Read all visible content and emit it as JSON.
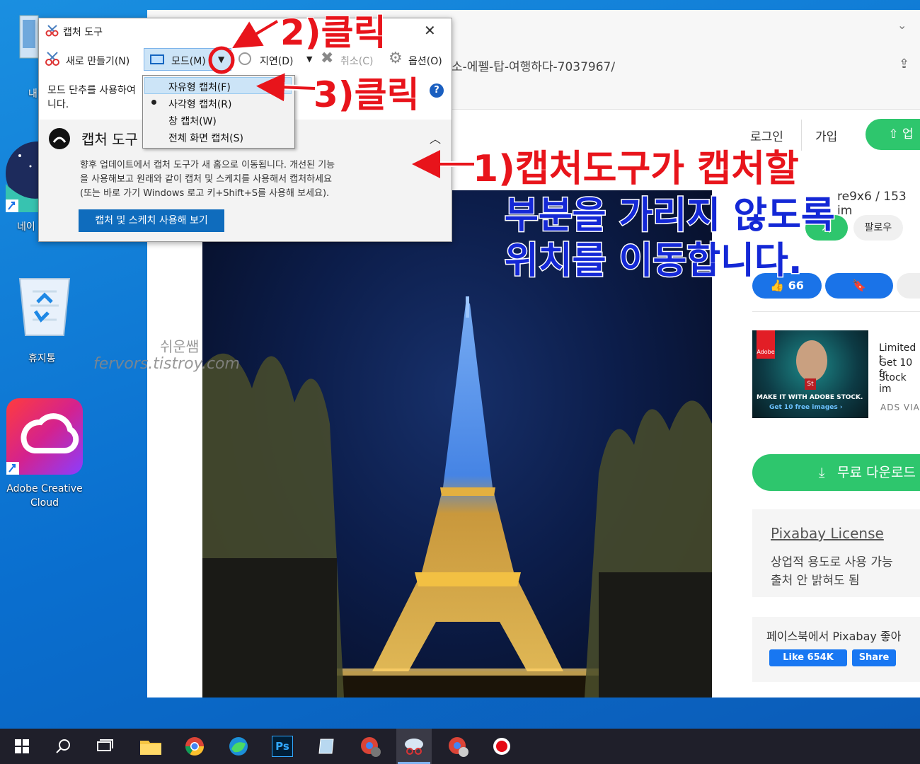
{
  "desktop": {
    "icons": [
      {
        "label": "내"
      },
      {
        "label": "네이"
      },
      {
        "label": "휴지통"
      },
      {
        "label": "Adobe Creative Cloud"
      }
    ],
    "watermark_line1": "쉬운쌤",
    "watermark_line2": "fervors.tistroy.com"
  },
  "browser": {
    "url": "소-에펠-탑-여행하다-7037967/",
    "login": "로그인",
    "join": "가입",
    "upload": "업",
    "author_stats": "re9x6 / 153 im",
    "follow_btn": "지",
    "follow_label": "팔로우",
    "likes": "66",
    "ad": {
      "line1": "Limited t",
      "line2": "Get 10 fr",
      "line3": "Stock im",
      "ads_via": "ADS VIA",
      "banner_title": "MAKE IT WITH ADOBE STOCK.",
      "banner_sub": "Get 10 free images ›",
      "brand": "Adobe",
      "st": "St"
    },
    "download": "무료 다운로드",
    "license_title": "Pixabay License",
    "license_line1": "상업적 용도로 사용 가능",
    "license_line2": "출처 안 밝혀도 됨",
    "fb_text": "페이스북에서 Pixabay 좋아",
    "fb_like": "Like 654K",
    "fb_share": "Share"
  },
  "snip": {
    "title": "캡처 도구",
    "new": "새로 만들기(N)",
    "mode": "모드(M)",
    "delay": "지연(D)",
    "cancel": "취소(C)",
    "options": "옵션(O)",
    "hint1": "모드 단추를 사용하여",
    "hint2": "니다.",
    "panel_title": "캡처 도구",
    "info1": "향후 업데이트에서 캡처 도구가 새 홈으로 이동됩니다. 개선된 기능",
    "info2": "을 사용해보고 원래와 같이 캡처 및 스케치를 사용해서 캡처하세요",
    "info3": "(또는 바로 가기 Windows 로고 키+Shift+S를 사용해 보세요).",
    "try_btn": "캡처 및 스케치 사용해 보기"
  },
  "mode_menu": {
    "items": [
      "자유형 캡처(F)",
      "사각형 캡처(R)",
      "창 캡처(W)",
      "전체 화면 캡처(S)"
    ],
    "selected": "사각형 캡처(R)"
  },
  "annotations": {
    "step1_line1": "1)캡처도구가 캡처할",
    "step1_line2": "부분을 가리지 않도록",
    "step1_line3": "위치를 이동합니다.",
    "step2": "2)클릭",
    "step3": "3)클릭"
  },
  "taskbar": {
    "icons": [
      "windows-start-icon",
      "search-icon",
      "task-view-icon",
      "file-explorer-icon",
      "chrome-icon",
      "edge-icon",
      "photoshop-icon",
      "notepad-icon",
      "chrome-profile-icon",
      "snipping-tool-icon",
      "chrome-app-icon",
      "record-icon"
    ],
    "ps_label": "Ps"
  },
  "colors": {
    "accent_green": "#2ec66d",
    "accent_blue": "#1a73e8",
    "annotation_red": "#e8141b",
    "annotation_blue": "#1428d6"
  }
}
